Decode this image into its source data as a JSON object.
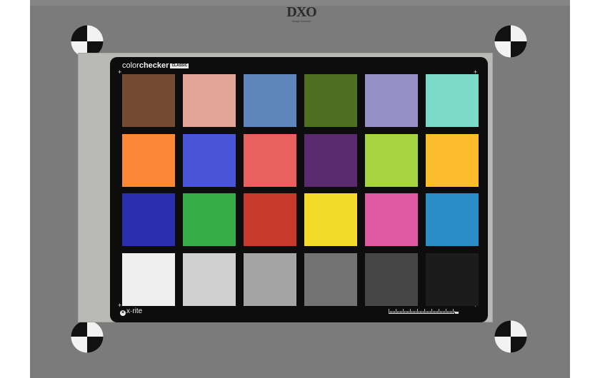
{
  "logo": {
    "mark": "DXO",
    "sub": "Image Science"
  },
  "card": {
    "brand_regular": "color",
    "brand_bold": "checker",
    "brand_badge": "CLASSIC",
    "footer_brand": "x·rite",
    "footer_icon": "×"
  },
  "patches": [
    {
      "name": "dark-skin",
      "color": "#734a32"
    },
    {
      "name": "light-skin",
      "color": "#e3a597"
    },
    {
      "name": "blue-sky",
      "color": "#5f85bd"
    },
    {
      "name": "foliage",
      "color": "#4c701f"
    },
    {
      "name": "blue-flower",
      "color": "#9891c7"
    },
    {
      "name": "bluish-green",
      "color": "#7bdac8"
    },
    {
      "name": "orange",
      "color": "#fb8837"
    },
    {
      "name": "purplish-blue",
      "color": "#4a54d6"
    },
    {
      "name": "moderate-red",
      "color": "#e9605f"
    },
    {
      "name": "purple",
      "color": "#5a2a6e"
    },
    {
      "name": "yellow-green",
      "color": "#a7d541"
    },
    {
      "name": "orange-yellow",
      "color": "#fbbd2c"
    },
    {
      "name": "blue",
      "color": "#2a2fae"
    },
    {
      "name": "green",
      "color": "#38ad46"
    },
    {
      "name": "red",
      "color": "#c7392a"
    },
    {
      "name": "yellow",
      "color": "#f3da2b"
    },
    {
      "name": "magenta",
      "color": "#df5aa2"
    },
    {
      "name": "cyan",
      "color": "#2c8ec6"
    },
    {
      "name": "white",
      "color": "#efefef"
    },
    {
      "name": "neutral-8",
      "color": "#cfcfcf"
    },
    {
      "name": "neutral-6-5",
      "color": "#a4a4a4"
    },
    {
      "name": "neutral-5",
      "color": "#737373"
    },
    {
      "name": "neutral-3-5",
      "color": "#464646"
    },
    {
      "name": "black",
      "color": "#1c1c1c"
    }
  ],
  "colors": {
    "board": "#7b7b7b",
    "card": "#0d0d0d",
    "mount": "#b9b9b6"
  }
}
